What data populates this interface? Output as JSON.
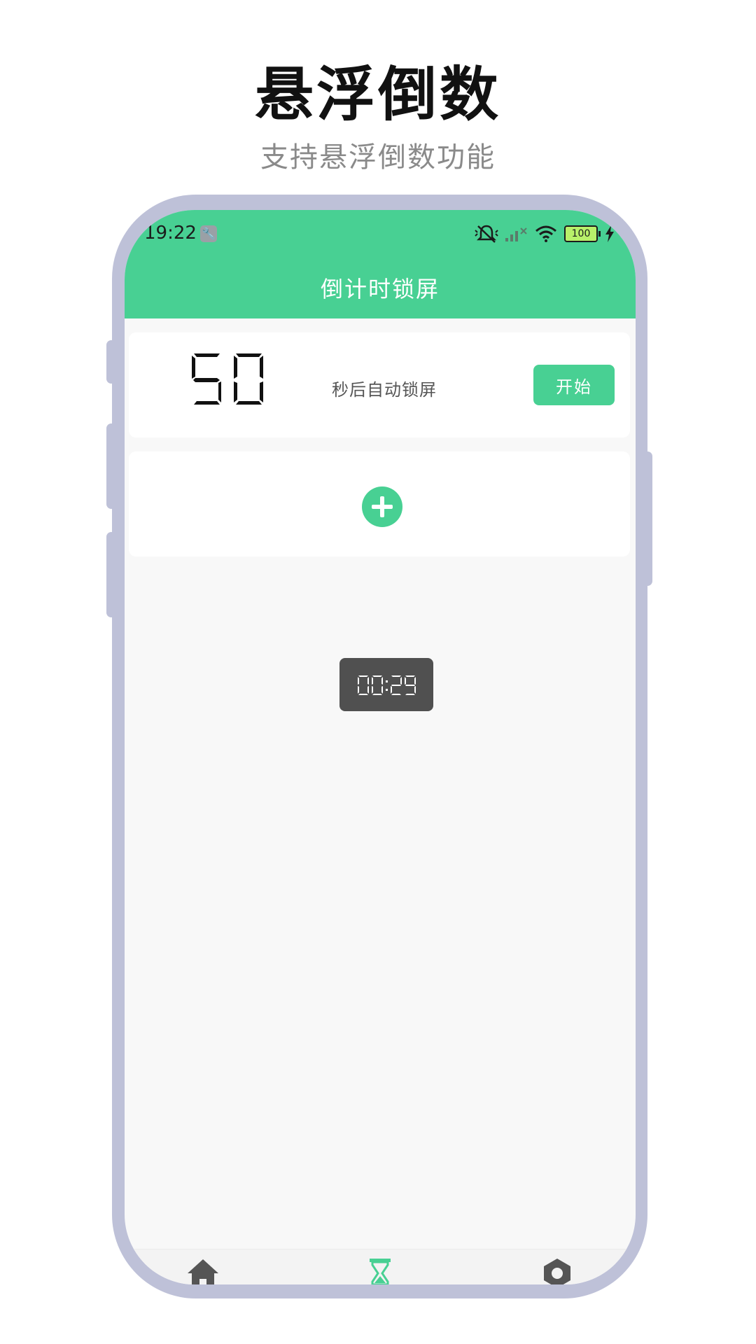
{
  "promo": {
    "title": "悬浮倒数",
    "subtitle": "支持悬浮倒数功能"
  },
  "status_bar": {
    "time": "19:22",
    "battery": "100",
    "icons": [
      "wrench-icon",
      "mute-icon",
      "signal-icon",
      "wifi-icon",
      "battery-icon",
      "charging-icon"
    ]
  },
  "header": {
    "title": "倒计时锁屏"
  },
  "timer_card": {
    "number": "50",
    "label": "秒后自动锁屏",
    "start_label": "开始"
  },
  "add_card": {
    "icon": "plus-icon"
  },
  "floating_timer": {
    "time": "00:29"
  },
  "bottom_nav": {
    "items": [
      {
        "icon": "home-icon"
      },
      {
        "icon": "hourglass-icon",
        "active": true
      },
      {
        "icon": "hexagon-settings-icon"
      }
    ],
    "active_color": "#48d093",
    "inactive_color": "#555555"
  },
  "colors": {
    "accent": "#48d093",
    "frame": "#bec1d8",
    "floating_bg": "#505050"
  }
}
